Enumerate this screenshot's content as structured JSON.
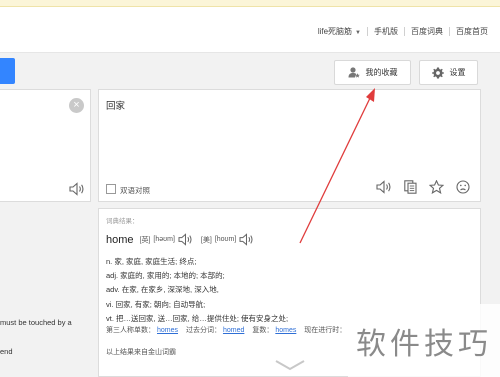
{
  "nav": {
    "user_label": "life死脑筋",
    "links": [
      "手机版",
      "百度词典",
      "百度首页"
    ]
  },
  "toolbar": {
    "favorites_label": "我的收藏",
    "settings_label": "设置"
  },
  "result": {
    "text": "回家",
    "bilingual_label": "双语对照"
  },
  "dict": {
    "title": "词典结果：",
    "word": "home",
    "uk_label": "[英]",
    "uk_phonetic": "[həʊm]",
    "us_label": "[美]",
    "us_phonetic": "[hoʊm]",
    "definitions": [
      "n. 家, 家庭, 家庭生活; 终点;",
      "adj. 家庭的, 家用的; 本地的; 本部的;",
      "adv. 在家, 在家乡, 深深地, 深入地,",
      "vi. 回家, 有家; 朝向; 自动导航;",
      "vt. 把…送回家, 送…回家, 给…提供住处; 使有安身之处;"
    ],
    "forms": [
      {
        "label": "第三人称单数：",
        "value": "homes"
      },
      {
        "label": "过去分词：",
        "value": "homed"
      },
      {
        "label": "复数：",
        "value": "homes"
      },
      {
        "label": "现在进行时：",
        "value": ""
      }
    ],
    "source_note": "以上结果来自金山词霸"
  },
  "left_fragments": [
    "must be touched by a",
    "end"
  ],
  "watermark": "软件技巧",
  "colors": {
    "accent_blue": "#3385ff",
    "arrow_red": "#e03c3c",
    "link_blue": "#2f6fd6"
  }
}
